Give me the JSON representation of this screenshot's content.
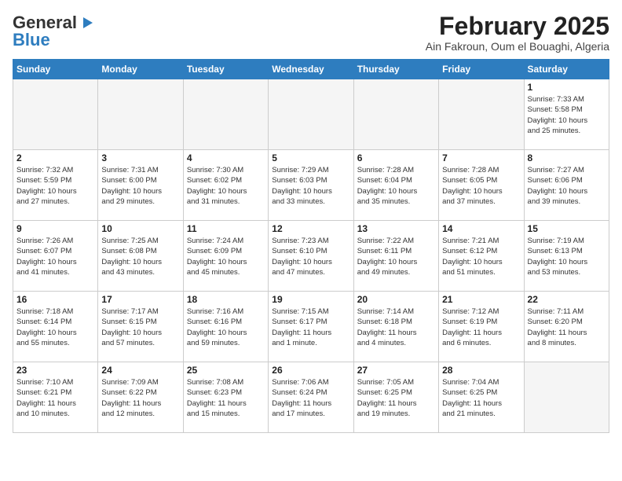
{
  "logo": {
    "line1": "General",
    "line2": "Blue"
  },
  "header": {
    "title": "February 2025",
    "subtitle": "Ain Fakroun, Oum el Bouaghi, Algeria"
  },
  "weekdays": [
    "Sunday",
    "Monday",
    "Tuesday",
    "Wednesday",
    "Thursday",
    "Friday",
    "Saturday"
  ],
  "weeks": [
    [
      {
        "day": "",
        "info": ""
      },
      {
        "day": "",
        "info": ""
      },
      {
        "day": "",
        "info": ""
      },
      {
        "day": "",
        "info": ""
      },
      {
        "day": "",
        "info": ""
      },
      {
        "day": "",
        "info": ""
      },
      {
        "day": "1",
        "info": "Sunrise: 7:33 AM\nSunset: 5:58 PM\nDaylight: 10 hours\nand 25 minutes."
      }
    ],
    [
      {
        "day": "2",
        "info": "Sunrise: 7:32 AM\nSunset: 5:59 PM\nDaylight: 10 hours\nand 27 minutes."
      },
      {
        "day": "3",
        "info": "Sunrise: 7:31 AM\nSunset: 6:00 PM\nDaylight: 10 hours\nand 29 minutes."
      },
      {
        "day": "4",
        "info": "Sunrise: 7:30 AM\nSunset: 6:02 PM\nDaylight: 10 hours\nand 31 minutes."
      },
      {
        "day": "5",
        "info": "Sunrise: 7:29 AM\nSunset: 6:03 PM\nDaylight: 10 hours\nand 33 minutes."
      },
      {
        "day": "6",
        "info": "Sunrise: 7:28 AM\nSunset: 6:04 PM\nDaylight: 10 hours\nand 35 minutes."
      },
      {
        "day": "7",
        "info": "Sunrise: 7:28 AM\nSunset: 6:05 PM\nDaylight: 10 hours\nand 37 minutes."
      },
      {
        "day": "8",
        "info": "Sunrise: 7:27 AM\nSunset: 6:06 PM\nDaylight: 10 hours\nand 39 minutes."
      }
    ],
    [
      {
        "day": "9",
        "info": "Sunrise: 7:26 AM\nSunset: 6:07 PM\nDaylight: 10 hours\nand 41 minutes."
      },
      {
        "day": "10",
        "info": "Sunrise: 7:25 AM\nSunset: 6:08 PM\nDaylight: 10 hours\nand 43 minutes."
      },
      {
        "day": "11",
        "info": "Sunrise: 7:24 AM\nSunset: 6:09 PM\nDaylight: 10 hours\nand 45 minutes."
      },
      {
        "day": "12",
        "info": "Sunrise: 7:23 AM\nSunset: 6:10 PM\nDaylight: 10 hours\nand 47 minutes."
      },
      {
        "day": "13",
        "info": "Sunrise: 7:22 AM\nSunset: 6:11 PM\nDaylight: 10 hours\nand 49 minutes."
      },
      {
        "day": "14",
        "info": "Sunrise: 7:21 AM\nSunset: 6:12 PM\nDaylight: 10 hours\nand 51 minutes."
      },
      {
        "day": "15",
        "info": "Sunrise: 7:19 AM\nSunset: 6:13 PM\nDaylight: 10 hours\nand 53 minutes."
      }
    ],
    [
      {
        "day": "16",
        "info": "Sunrise: 7:18 AM\nSunset: 6:14 PM\nDaylight: 10 hours\nand 55 minutes."
      },
      {
        "day": "17",
        "info": "Sunrise: 7:17 AM\nSunset: 6:15 PM\nDaylight: 10 hours\nand 57 minutes."
      },
      {
        "day": "18",
        "info": "Sunrise: 7:16 AM\nSunset: 6:16 PM\nDaylight: 10 hours\nand 59 minutes."
      },
      {
        "day": "19",
        "info": "Sunrise: 7:15 AM\nSunset: 6:17 PM\nDaylight: 11 hours\nand 1 minute."
      },
      {
        "day": "20",
        "info": "Sunrise: 7:14 AM\nSunset: 6:18 PM\nDaylight: 11 hours\nand 4 minutes."
      },
      {
        "day": "21",
        "info": "Sunrise: 7:12 AM\nSunset: 6:19 PM\nDaylight: 11 hours\nand 6 minutes."
      },
      {
        "day": "22",
        "info": "Sunrise: 7:11 AM\nSunset: 6:20 PM\nDaylight: 11 hours\nand 8 minutes."
      }
    ],
    [
      {
        "day": "23",
        "info": "Sunrise: 7:10 AM\nSunset: 6:21 PM\nDaylight: 11 hours\nand 10 minutes."
      },
      {
        "day": "24",
        "info": "Sunrise: 7:09 AM\nSunset: 6:22 PM\nDaylight: 11 hours\nand 12 minutes."
      },
      {
        "day": "25",
        "info": "Sunrise: 7:08 AM\nSunset: 6:23 PM\nDaylight: 11 hours\nand 15 minutes."
      },
      {
        "day": "26",
        "info": "Sunrise: 7:06 AM\nSunset: 6:24 PM\nDaylight: 11 hours\nand 17 minutes."
      },
      {
        "day": "27",
        "info": "Sunrise: 7:05 AM\nSunset: 6:25 PM\nDaylight: 11 hours\nand 19 minutes."
      },
      {
        "day": "28",
        "info": "Sunrise: 7:04 AM\nSunset: 6:25 PM\nDaylight: 11 hours\nand 21 minutes."
      },
      {
        "day": "",
        "info": ""
      }
    ]
  ]
}
